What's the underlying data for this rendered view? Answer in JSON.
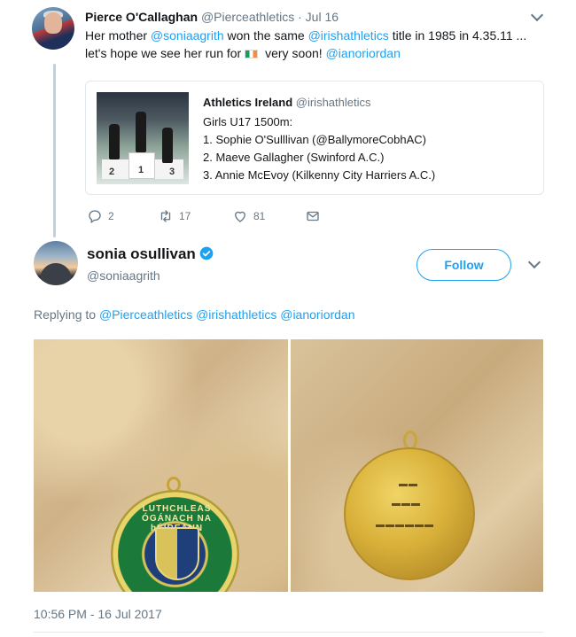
{
  "tweet1": {
    "name": "Pierce O'Callaghan",
    "handle": "@Pierceathletics",
    "separator": " · ",
    "date": "Jul 16",
    "text": {
      "p1": "Her mother ",
      "m1": "@soniaagrith",
      "p2": " won the same ",
      "m2": "@irishathletics",
      "p3": " title in 1985 in 4.35.11 ...",
      "p4": "let's hope we see her run for",
      "p5": " very soon! ",
      "m3": "@ianoriordan"
    },
    "quote": {
      "name": "Athletics Ireland",
      "handle": "@irishathletics",
      "lines": [
        "Girls U17 1500m:",
        "1. Sophie O'Sulllivan (@BallymoreCobhAC)",
        "2. Maeve Gallagher (Swinford A.C.)",
        "3. Annie McEvoy (Kilkenny City Harriers A.C.)"
      ],
      "podium_numbers": [
        "2",
        "1",
        "3"
      ]
    },
    "actions": {
      "replies": "2",
      "retweets": "17",
      "likes": "81"
    }
  },
  "reply": {
    "name": "sonia osullivan",
    "handle": "@soniaagrith",
    "follow_label": "Follow",
    "replying_prefix": "Replying to ",
    "replying_to": [
      "@Pierceathletics",
      "@irishathletics",
      "@ianoriordan"
    ],
    "medal_front_text": "LUTHCHLEAS ÓGÁNACH NA hÉIREANN",
    "timestamp": "10:56 PM - 16 Jul 2017"
  },
  "colors": {
    "accent": "#1da1f2",
    "muted": "#657786",
    "text": "#14171a",
    "border": "#e1e8ed"
  },
  "icons": [
    "reply-icon",
    "retweet-icon",
    "like-icon",
    "dm-icon",
    "verified-icon",
    "chevron-down-icon",
    "ireland-flag-icon"
  ]
}
